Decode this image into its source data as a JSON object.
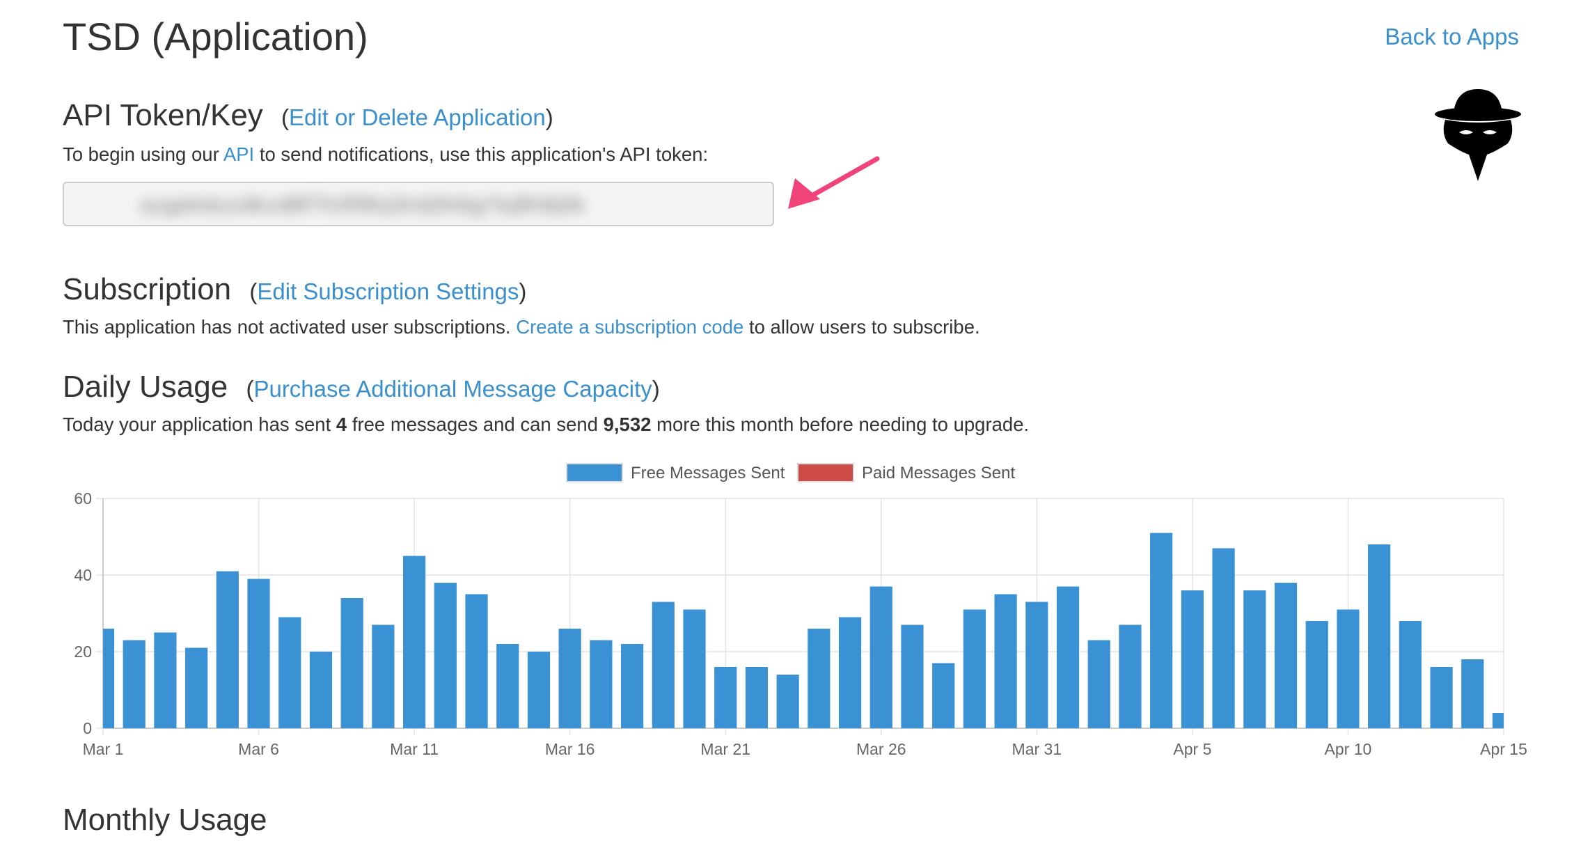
{
  "page": {
    "title": "TSD (Application)",
    "back_link": "Back to Apps"
  },
  "api": {
    "heading": "API Token/Key",
    "paren_open": "(",
    "edit_link": "Edit or Delete Application",
    "paren_close": ")",
    "desc_pre": "To begin using our ",
    "desc_link": "API",
    "desc_post": " to send notifications, use this application's API token:",
    "token": "azgekduzdkzd8f7h3f9hj2k4j5h6g7kj8h9j0k"
  },
  "subscription": {
    "heading": "Subscription",
    "paren_open": "(",
    "edit_link": "Edit Subscription Settings",
    "paren_close": ")",
    "desc_pre": "This application has not activated user subscriptions. ",
    "desc_link": "Create a subscription code",
    "desc_post": " to allow users to subscribe."
  },
  "daily": {
    "heading": "Daily Usage",
    "paren_open": "(",
    "link": "Purchase Additional Message Capacity",
    "paren_close": ")",
    "desc_pre": "Today your application has sent ",
    "sent_count": "4",
    "desc_mid": " free messages and can send ",
    "remaining": "9,532",
    "desc_post": " more this month before needing to upgrade."
  },
  "monthly": {
    "heading": "Monthly Usage"
  },
  "colors": {
    "link": "#3a8fcd",
    "free_series": "#3a92d4",
    "paid_series": "#cd4b48",
    "arrow": "#f0437a"
  },
  "chart_data": {
    "type": "bar",
    "legend_position": "top",
    "grid": true,
    "ylim": [
      0,
      60
    ],
    "y_ticks": [
      0,
      20,
      40,
      60
    ],
    "x_tick_labels": [
      "Mar 1",
      "Mar 6",
      "Mar 11",
      "Mar 16",
      "Mar 21",
      "Mar 26",
      "Mar 31",
      "Apr 5",
      "Apr 10",
      "Apr 15"
    ],
    "categories": [
      "Mar 1",
      "Mar 2",
      "Mar 3",
      "Mar 4",
      "Mar 5",
      "Mar 6",
      "Mar 7",
      "Mar 8",
      "Mar 9",
      "Mar 10",
      "Mar 11",
      "Mar 12",
      "Mar 13",
      "Mar 14",
      "Mar 15",
      "Mar 16",
      "Mar 17",
      "Mar 18",
      "Mar 19",
      "Mar 20",
      "Mar 21",
      "Mar 22",
      "Mar 23",
      "Mar 24",
      "Mar 25",
      "Mar 26",
      "Mar 27",
      "Mar 28",
      "Mar 29",
      "Mar 30",
      "Mar 31",
      "Apr 1",
      "Apr 2",
      "Apr 3",
      "Apr 4",
      "Apr 5",
      "Apr 6",
      "Apr 7",
      "Apr 8",
      "Apr 9",
      "Apr 10",
      "Apr 11",
      "Apr 12",
      "Apr 13",
      "Apr 14",
      "Apr 15"
    ],
    "series": [
      {
        "name": "Free Messages Sent",
        "color": "#3a92d4",
        "values": [
          26,
          23,
          25,
          21,
          41,
          39,
          29,
          20,
          34,
          27,
          45,
          38,
          35,
          22,
          20,
          26,
          23,
          22,
          33,
          31,
          16,
          16,
          14,
          26,
          29,
          37,
          27,
          17,
          31,
          35,
          33,
          37,
          23,
          27,
          51,
          36,
          47,
          36,
          38,
          28,
          31,
          48,
          28,
          16,
          18,
          4
        ]
      },
      {
        "name": "Paid Messages Sent",
        "color": "#cd4b48",
        "values": [
          0,
          0,
          0,
          0,
          0,
          0,
          0,
          0,
          0,
          0,
          0,
          0,
          0,
          0,
          0,
          0,
          0,
          0,
          0,
          0,
          0,
          0,
          0,
          0,
          0,
          0,
          0,
          0,
          0,
          0,
          0,
          0,
          0,
          0,
          0,
          0,
          0,
          0,
          0,
          0,
          0,
          0,
          0,
          0,
          0,
          0
        ]
      }
    ]
  }
}
